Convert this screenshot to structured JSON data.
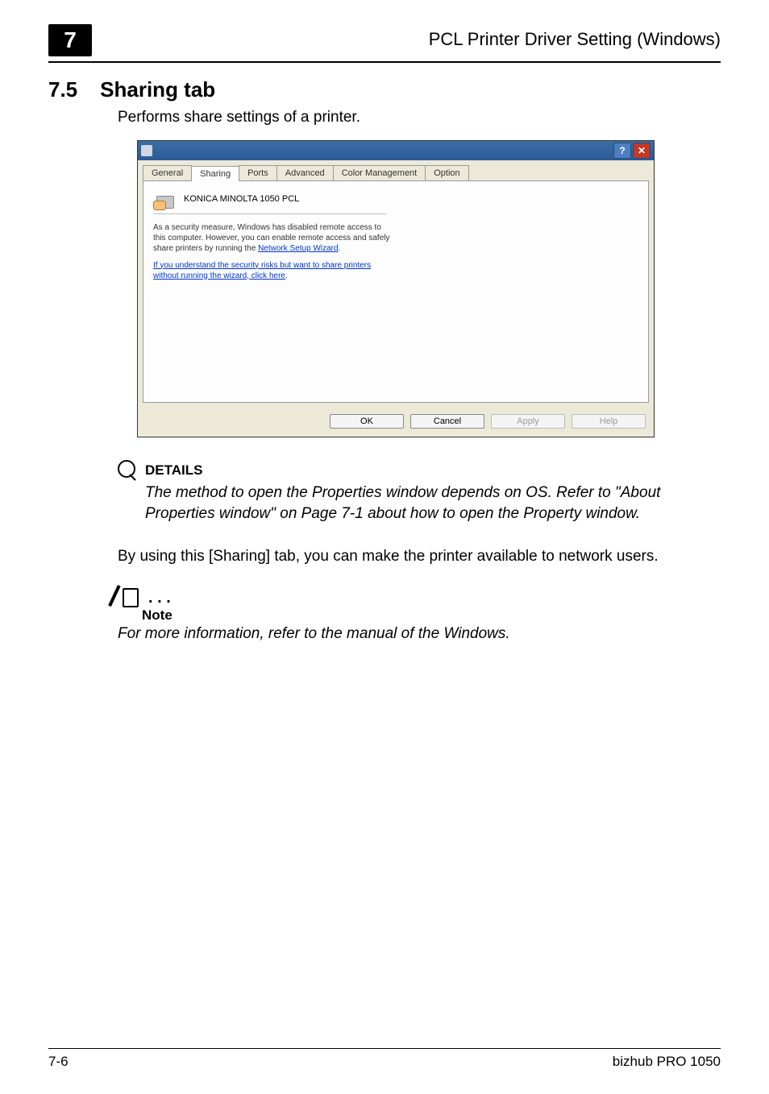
{
  "header": {
    "chapter_number": "7",
    "header_text": "PCL Printer Driver Setting (Windows)"
  },
  "section": {
    "number": "7.5",
    "title": "Sharing tab",
    "intro": "Performs share settings of a printer."
  },
  "dialog": {
    "titlebar_icon_alt": "printer",
    "help_glyph": "?",
    "close_glyph": "✕",
    "tabs": {
      "general": "General",
      "sharing": "Sharing",
      "ports": "Ports",
      "advanced": "Advanced",
      "color_management": "Color Management",
      "option": "Option"
    },
    "printer_name": "KONICA MINOLTA 1050 PCL",
    "security_msg_pre": "As a security measure, Windows has disabled remote access to this computer. However, you can enable remote access and safely share printers by running the ",
    "security_link1": "Network Setup Wizard",
    "security_msg_post": ".",
    "risk_link": "If you understand the security risks but want to share printers without running the wizard, click here",
    "buttons": {
      "ok": "OK",
      "cancel": "Cancel",
      "apply": "Apply",
      "help": "Help"
    }
  },
  "details": {
    "heading": "DETAILS",
    "body": "The method to open the Properties window depends on OS. Refer to \"About Properties window\" on Page 7-1 about how to open the Property window."
  },
  "paragraph2": "By using this [Sharing] tab, you can make the printer available to network users.",
  "note": {
    "dots": ". . .",
    "label": "Note",
    "body": "For more information, refer to the manual of the Windows."
  },
  "footer": {
    "page_number": "7-6",
    "product": "bizhub PRO 1050"
  }
}
